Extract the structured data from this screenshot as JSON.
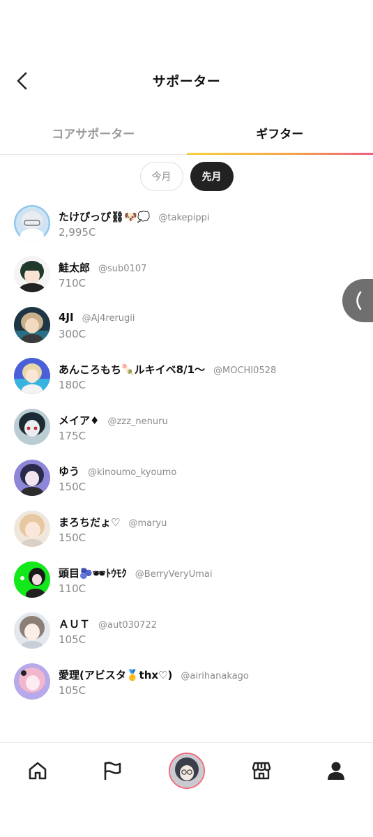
{
  "header": {
    "title": "サポーター",
    "back_icon": "chevron-left-icon"
  },
  "tabs": [
    {
      "label": "コアサポーター",
      "active": false
    },
    {
      "label": "ギフター",
      "active": true
    }
  ],
  "period": [
    {
      "label": "今月",
      "selected": false
    },
    {
      "label": "先月",
      "selected": true
    }
  ],
  "supporters": [
    {
      "name": "たけぴっぴ⛓🐶💭",
      "handle": "@takepippi",
      "coins": "2,995C"
    },
    {
      "name": "鮭太郎",
      "handle": "@sub0107",
      "coins": "710C"
    },
    {
      "name": "4JI",
      "handle": "@Aj4rerugii",
      "coins": "300C"
    },
    {
      "name": "あんころもち🍡ルキイベ8/1〜",
      "handle": "@MOCHI0528",
      "coins": "180C"
    },
    {
      "name": "メイア♦",
      "handle": "@zzz_nenuru",
      "coins": "175C"
    },
    {
      "name": "ゆう",
      "handle": "@kinoumo_kyoumo",
      "coins": "150C"
    },
    {
      "name": "まろちだょ♡",
      "handle": "@maryu",
      "coins": "150C"
    },
    {
      "name": "頭目🫐🕶ﾄｳﾓｸ",
      "handle": "@BerryVeryUmai",
      "coins": "110C"
    },
    {
      "name": "ＡＵＴ",
      "handle": "@aut030722",
      "coins": "105C"
    },
    {
      "name": "愛理(アビスタ🥇thx♡)",
      "handle": "@airihanakago",
      "coins": "105C"
    }
  ],
  "side_tab_icon": "chevron-left-icon",
  "bottom_nav": [
    "home-icon",
    "flag-icon",
    "profile-avatar",
    "store-icon",
    "person-icon"
  ],
  "colors": {
    "tab_underline": [
      "#f7d33a",
      "#f5a64a",
      "#ee5f80"
    ],
    "selected_pill": "#222222",
    "side_tab": "#6f6f6f"
  }
}
